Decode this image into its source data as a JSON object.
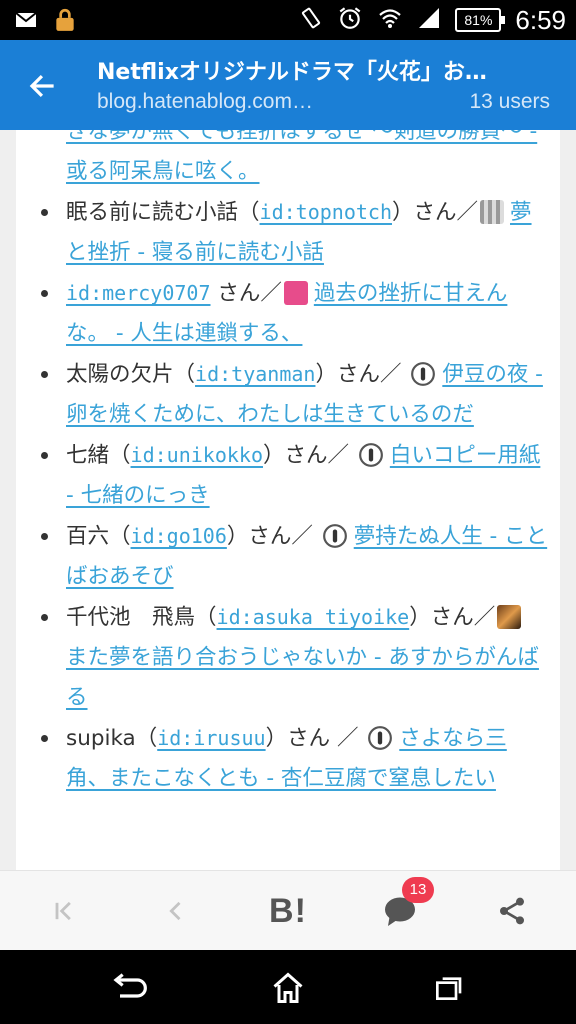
{
  "status_bar": {
    "time": "6:59",
    "battery": "81%",
    "icons": [
      "mail-icon",
      "lock-icon",
      "vibrate-icon",
      "alarm-icon",
      "wifi-icon",
      "signal-icon",
      "battery-icon"
    ]
  },
  "app_bar": {
    "title": "Netflixオリジナルドラマ「火花」お…",
    "url": "blog.hatenablog.com…",
    "users": "13 users"
  },
  "entries": [
    {
      "type": "cont",
      "link": "きな夢が無くても挫折はするぜ ～剣道の勝負～ - 或る阿呆鳥に呟く。"
    },
    {
      "name": "眠る前に読む小話",
      "open": "（",
      "id": "id:topnotch",
      "close": "）",
      "san": "さん／",
      "icon": "gray",
      "link": "夢と挫折 - 寝る前に読む小話"
    },
    {
      "name": "",
      "open": "",
      "id": "id:mercy0707",
      "close": "",
      "san": " さん／",
      "icon": "pink",
      "link": "過去の挫折に甘えんな。 - 人生は連鎖する、"
    },
    {
      "name": "太陽の欠片",
      "open": "（",
      "id": "id:tyanman",
      "close": "）",
      "san": "さん／ ",
      "icon": "hatena",
      "link": "伊豆の夜 - 卵を焼くために、わたしは生きているのだ"
    },
    {
      "name": "七緒",
      "open": "（",
      "id": "id:unikokko",
      "close": "）",
      "san": "さん／ ",
      "icon": "hatena",
      "link": "白いコピー用紙 - 七緒のにっき"
    },
    {
      "name": "百六",
      "open": "（",
      "id": "id:go106",
      "close": "）",
      "san": "さん／ ",
      "icon": "hatena",
      "link": "夢持たぬ人生 - ことばおあそび"
    },
    {
      "name": "千代池　飛鳥",
      "open": "（",
      "id": "id:asuka_tiyoike",
      "close": "）",
      "san": "さん／",
      "icon": "cat",
      "link": "また夢を語り合おうじゃないか - あすからがんばる"
    },
    {
      "name": "supika",
      "open": "（",
      "id": "id:irusuu",
      "close": "）",
      "san": "さん ／ ",
      "icon": "hatena",
      "link": "さよなら三角、またこなくとも - 杏仁豆腐で窒息したい"
    }
  ],
  "toolbar": {
    "bookmark_label": "B!",
    "comment_count": "13",
    "icons": [
      "first-page-icon",
      "prev-icon",
      "hatena-bookmark-icon",
      "comment-icon",
      "share-icon"
    ]
  },
  "navbar": {
    "icons": [
      "back-nav-icon",
      "home-icon",
      "recents-icon"
    ]
  },
  "colors": {
    "app_bar": "#1b7fd6",
    "link": "#3aa3d8",
    "badge": "#ef3b50"
  }
}
